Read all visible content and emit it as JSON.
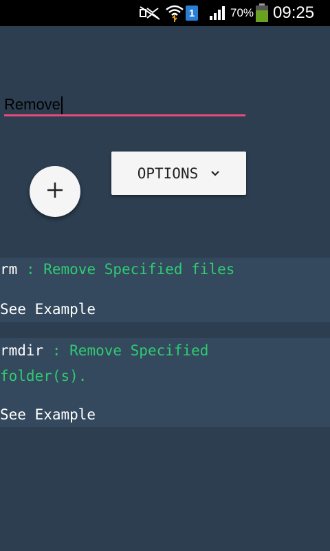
{
  "status_bar": {
    "battery_percent": "70%",
    "time": "09:25",
    "sim_number": "1",
    "icons": [
      "mute-icon",
      "wifi-icon",
      "sim-icon",
      "signal-icon",
      "battery-icon"
    ]
  },
  "search": {
    "value": "Remove"
  },
  "options_button": {
    "label": "OPTIONS"
  },
  "add_button": {
    "icon": "plus-icon"
  },
  "results": [
    {
      "command": "rm",
      "separator": " : ",
      "description": "Remove Specified files",
      "example_label": "See Example"
    },
    {
      "command": "rmdir",
      "separator": " : ",
      "description_line1": "Remove Specified",
      "description_line2": "folder(s).",
      "example_label": "See Example"
    }
  ],
  "colors": {
    "background": "#2c3e50",
    "card": "#34495e",
    "accent_underline": "#e84a7a",
    "description_green": "#2ecc71",
    "battery_green": "#6aa121"
  }
}
